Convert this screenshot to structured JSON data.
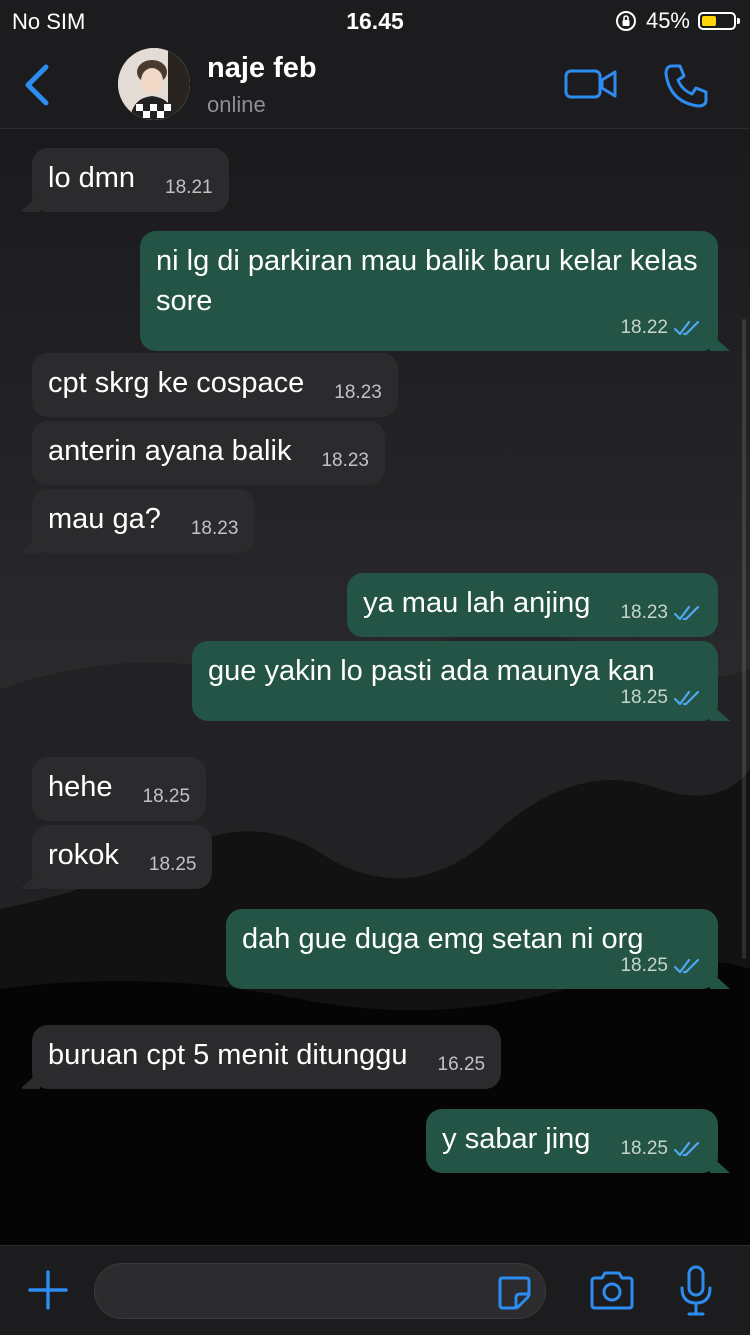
{
  "status_bar": {
    "carrier": "No SIM",
    "time": "16.45",
    "battery_percent": "45%",
    "battery_level": 0.45,
    "battery_color": "#ffd60a"
  },
  "header": {
    "back_icon": "chevron-left-icon",
    "contact_name": "naje feb",
    "contact_status": "online",
    "video_icon": "video-camera-icon",
    "call_icon": "phone-icon",
    "accent_color": "#2d8cf0"
  },
  "messages": [
    {
      "direction": "in",
      "text": "lo dmn",
      "time": "18.21"
    },
    {
      "direction": "out",
      "text": "ni lg di parkiran mau balik baru kelar kelas sore",
      "time": "18.22",
      "status": "read"
    },
    {
      "direction": "in",
      "text": "cpt skrg ke cospace",
      "time": "18.23"
    },
    {
      "direction": "in",
      "text": "anterin ayana balik",
      "time": "18.23"
    },
    {
      "direction": "in",
      "text": "mau ga?",
      "time": "18.23"
    },
    {
      "direction": "out",
      "text": "ya mau lah anjing",
      "time": "18.23",
      "status": "read"
    },
    {
      "direction": "out",
      "text": "gue yakin lo pasti ada maunya kan",
      "time": "18.25",
      "status": "read"
    },
    {
      "direction": "in",
      "text": "hehe",
      "time": "18.25"
    },
    {
      "direction": "in",
      "text": "rokok",
      "time": "18.25"
    },
    {
      "direction": "out",
      "text": "dah gue duga emg setan ni org",
      "time": "18.25",
      "status": "read"
    },
    {
      "direction": "in",
      "text": "buruan cpt 5 menit ditunggu",
      "time": "16.25"
    },
    {
      "direction": "out",
      "text": "y sabar jing",
      "time": "18.25",
      "status": "read"
    }
  ],
  "input_bar": {
    "plus_icon": "plus-icon",
    "message_value": "",
    "sticker_icon": "sticker-icon",
    "camera_icon": "camera-icon",
    "mic_icon": "microphone-icon"
  },
  "colors": {
    "incoming_bubble": "#2b2b2d",
    "outgoing_bubble": "#235445",
    "read_ticks": "#4fa8f0"
  }
}
